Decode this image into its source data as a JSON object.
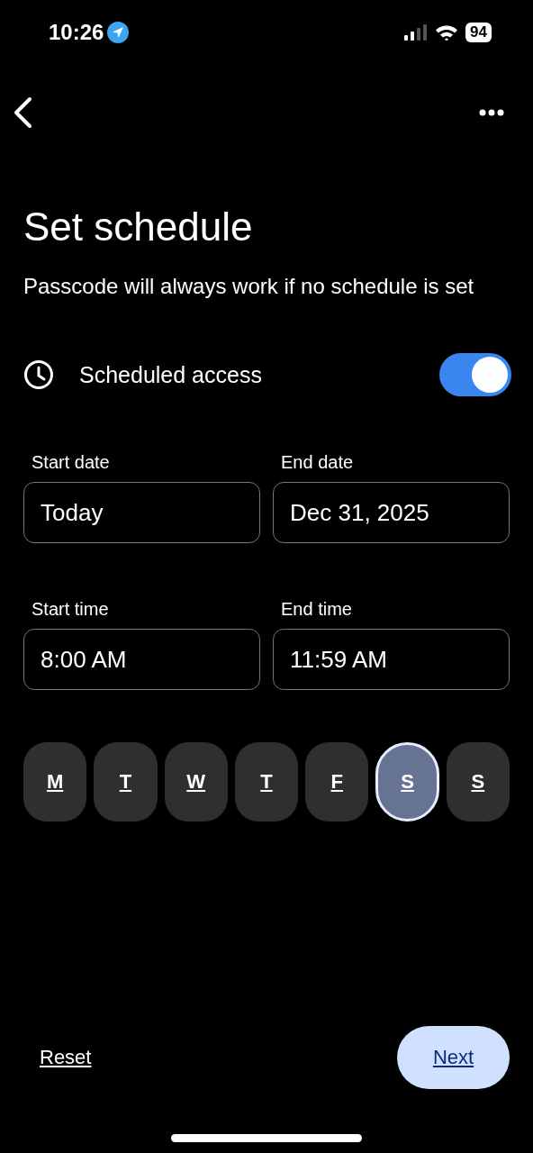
{
  "status_bar": {
    "time": "10:26",
    "battery": "94"
  },
  "title": "Set schedule",
  "subtitle": "Passcode will always work if no schedule is set",
  "scheduled_access": {
    "label": "Scheduled access",
    "on": true
  },
  "date_fields": [
    {
      "label": "Start date",
      "value": "Today"
    },
    {
      "label": "End date",
      "value": "Dec 31, 2025"
    }
  ],
  "time_fields": [
    {
      "label": "Start time",
      "value": "8:00 AM"
    },
    {
      "label": "End time",
      "value": "11:59 AM"
    }
  ],
  "days": [
    {
      "label": "M",
      "selected": false
    },
    {
      "label": "T",
      "selected": false
    },
    {
      "label": "W",
      "selected": false
    },
    {
      "label": "T",
      "selected": false
    },
    {
      "label": "F",
      "selected": false
    },
    {
      "label": "S",
      "selected": true
    },
    {
      "label": "S",
      "selected": false
    }
  ],
  "buttons": {
    "reset": "Reset",
    "next": "Next"
  }
}
